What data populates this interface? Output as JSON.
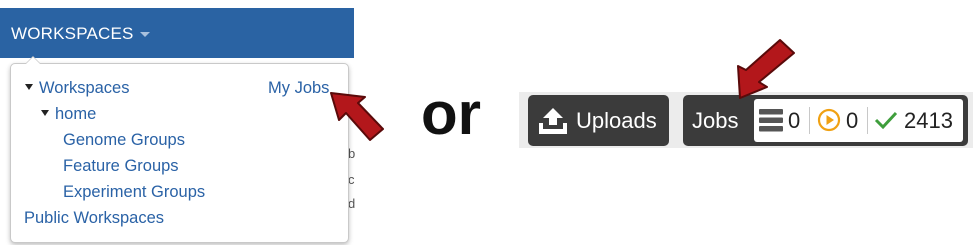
{
  "left": {
    "menu_title": "WORKSPACES",
    "dropdown": {
      "workspaces": "Workspaces",
      "my_jobs": "My Jobs",
      "home": "home",
      "items": [
        "Genome Groups",
        "Feature Groups",
        "Experiment Groups"
      ],
      "public_workspaces": "Public Workspaces"
    }
  },
  "separator_text": "or",
  "toolbar": {
    "uploads_label": "Uploads",
    "jobs_label": "Jobs",
    "queued_count": "0",
    "running_count": "0",
    "completed_count": "2413"
  },
  "colors": {
    "nav_blue": "#2a63a3",
    "link_blue": "#2a62a6",
    "button_dark": "#3b3b3b",
    "arrow_red": "#b3171b",
    "running_orange": "#f0a113",
    "completed_green": "#3f9e3c"
  },
  "icons": {
    "uploads": "upload-tray-icon",
    "queued": "server-stack-icon",
    "running": "play-circle-icon",
    "completed": "checkmark-icon"
  }
}
